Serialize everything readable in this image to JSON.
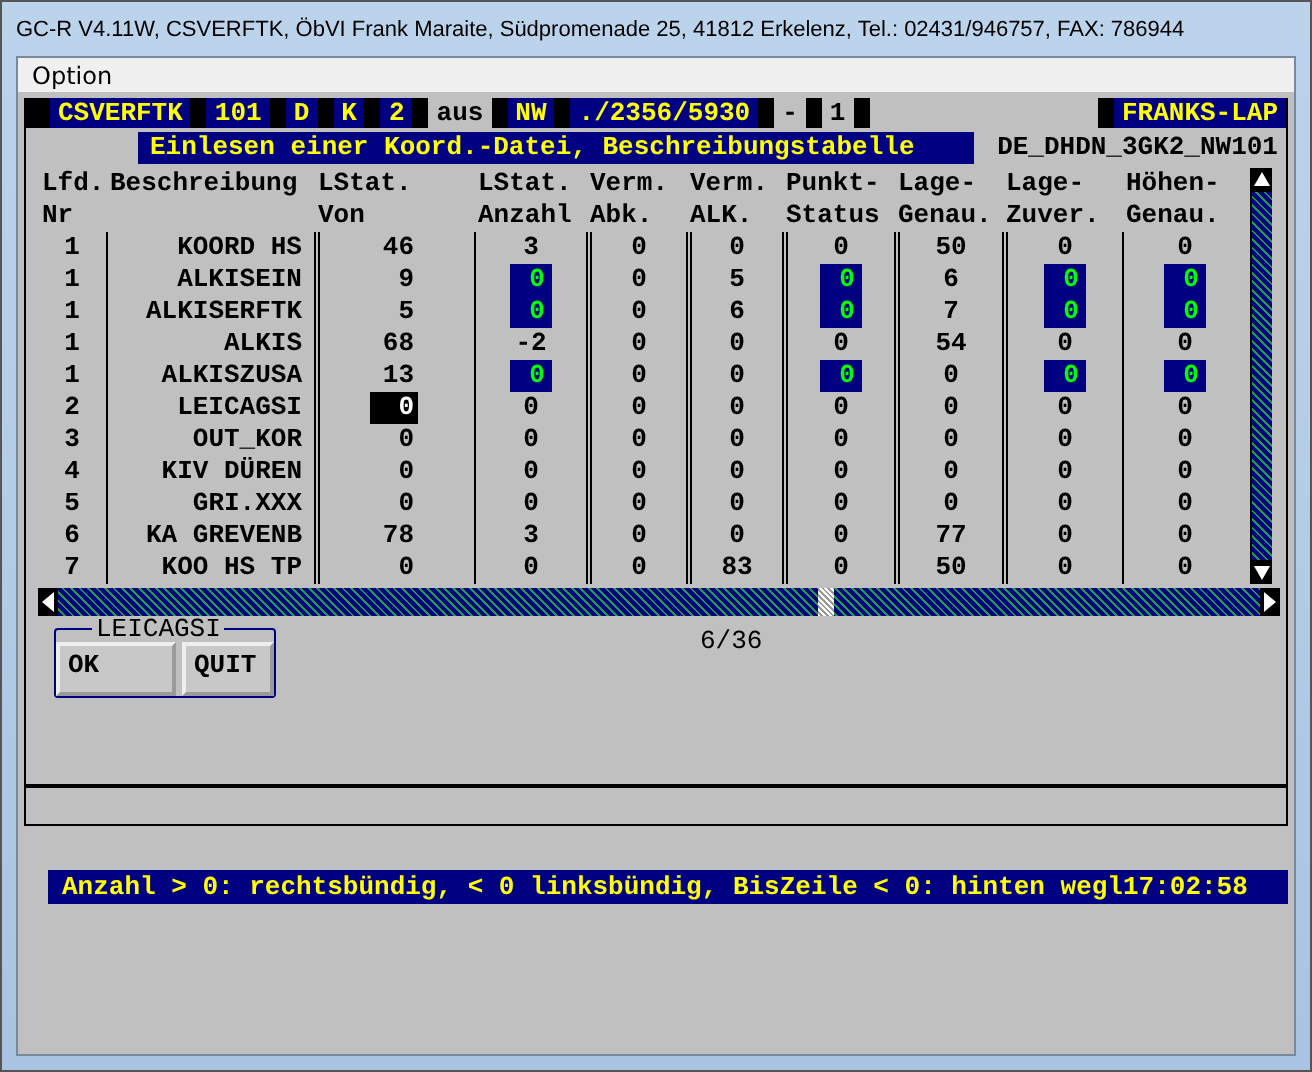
{
  "window": {
    "title": "GC-R V4.11W, CSVERFTK, ÖbVI Frank Maraite, Südpromenade 25, 41812 Erkelenz, Tel.: 02431/946757, FAX: 786944"
  },
  "menu": [
    "Option"
  ],
  "top_bar": [
    {
      "text": "CSVERFTK",
      "highlighted": true
    },
    {
      "text": "101",
      "highlighted": true
    },
    {
      "text": "D",
      "highlighted": true
    },
    {
      "text": "K",
      "highlighted": true
    },
    {
      "text": "2",
      "highlighted": true
    },
    {
      "text": "aus",
      "highlighted": false
    },
    {
      "text": "NW",
      "highlighted": true
    },
    {
      "text": "./2356/5930",
      "highlighted": true
    },
    {
      "text": "-",
      "highlighted": false
    },
    {
      "text": "1",
      "highlighted": false
    },
    {
      "text": "FRANKS-LAP",
      "highlighted": true
    }
  ],
  "heading": {
    "title": "Einlesen einer Koord.-Datei, Beschreibungstabelle",
    "file": "DE_DHDN_3GK2_NW101"
  },
  "table": {
    "columns": [
      {
        "line1": "Lfd.",
        "line2": "Nr"
      },
      {
        "line2": "Beschreibung"
      },
      {
        "line1": "LStat.",
        "line2": "Von"
      },
      {
        "line1": "LStat.",
        "line2": "Anzahl"
      },
      {
        "line1": "Verm.",
        "line2": "Abk."
      },
      {
        "line1": "Verm.",
        "line2": "ALK."
      },
      {
        "line1": "Punkt-",
        "line2": "Status"
      },
      {
        "line1": "Lage-",
        "line2": "Genau."
      },
      {
        "line1": "Lage-",
        "line2": "Zuver."
      },
      {
        "line1": "Höhen-",
        "line2": "Genau."
      }
    ],
    "rows": [
      {
        "cells": [
          {
            "text": "1",
            "highlighted": false,
            "selected": false
          },
          {
            "text": "KOORD HS",
            "highlighted": false,
            "selected": false
          },
          {
            "text": "46",
            "highlighted": false,
            "selected": false
          },
          {
            "text": "3",
            "highlighted": false,
            "selected": false
          },
          {
            "text": "0",
            "highlighted": false,
            "selected": false
          },
          {
            "text": "0",
            "highlighted": false,
            "selected": false
          },
          {
            "text": "0",
            "highlighted": false,
            "selected": false
          },
          {
            "text": "50",
            "highlighted": false,
            "selected": false
          },
          {
            "text": "0",
            "highlighted": false,
            "selected": false
          },
          {
            "text": "0",
            "highlighted": false,
            "selected": false
          }
        ]
      },
      {
        "cells": [
          {
            "text": "1",
            "highlighted": false,
            "selected": false
          },
          {
            "text": "ALKISEIN",
            "highlighted": false,
            "selected": false
          },
          {
            "text": "9",
            "highlighted": false,
            "selected": false
          },
          {
            "text": "0",
            "highlighted": true,
            "selected": false
          },
          {
            "text": "0",
            "highlighted": false,
            "selected": false
          },
          {
            "text": "5",
            "highlighted": false,
            "selected": false
          },
          {
            "text": "0",
            "highlighted": true,
            "selected": false
          },
          {
            "text": "6",
            "highlighted": false,
            "selected": false
          },
          {
            "text": "0",
            "highlighted": true,
            "selected": false
          },
          {
            "text": "0",
            "highlighted": true,
            "selected": false
          }
        ]
      },
      {
        "cells": [
          {
            "text": "1",
            "highlighted": false,
            "selected": false
          },
          {
            "text": "ALKISERFTK",
            "highlighted": false,
            "selected": false
          },
          {
            "text": "5",
            "highlighted": false,
            "selected": false
          },
          {
            "text": "0",
            "highlighted": true,
            "selected": false
          },
          {
            "text": "0",
            "highlighted": false,
            "selected": false
          },
          {
            "text": "6",
            "highlighted": false,
            "selected": false
          },
          {
            "text": "0",
            "highlighted": true,
            "selected": false
          },
          {
            "text": "7",
            "highlighted": false,
            "selected": false
          },
          {
            "text": "0",
            "highlighted": true,
            "selected": false
          },
          {
            "text": "0",
            "highlighted": true,
            "selected": false
          }
        ]
      },
      {
        "cells": [
          {
            "text": "1",
            "highlighted": false,
            "selected": false
          },
          {
            "text": "ALKIS",
            "highlighted": false,
            "selected": false
          },
          {
            "text": "68",
            "highlighted": false,
            "selected": false
          },
          {
            "text": "-2",
            "highlighted": false,
            "selected": false
          },
          {
            "text": "0",
            "highlighted": false,
            "selected": false
          },
          {
            "text": "0",
            "highlighted": false,
            "selected": false
          },
          {
            "text": "0",
            "highlighted": false,
            "selected": false
          },
          {
            "text": "54",
            "highlighted": false,
            "selected": false
          },
          {
            "text": "0",
            "highlighted": false,
            "selected": false
          },
          {
            "text": "0",
            "highlighted": false,
            "selected": false
          }
        ]
      },
      {
        "cells": [
          {
            "text": "1",
            "highlighted": false,
            "selected": false
          },
          {
            "text": "ALKISZUSA",
            "highlighted": false,
            "selected": false
          },
          {
            "text": "13",
            "highlighted": false,
            "selected": false
          },
          {
            "text": "0",
            "highlighted": true,
            "selected": false
          },
          {
            "text": "0",
            "highlighted": false,
            "selected": false
          },
          {
            "text": "0",
            "highlighted": false,
            "selected": false
          },
          {
            "text": "0",
            "highlighted": true,
            "selected": false
          },
          {
            "text": "0",
            "highlighted": false,
            "selected": false
          },
          {
            "text": "0",
            "highlighted": true,
            "selected": false
          },
          {
            "text": "0",
            "highlighted": true,
            "selected": false
          }
        ]
      },
      {
        "cells": [
          {
            "text": "2",
            "highlighted": false,
            "selected": false
          },
          {
            "text": "LEICAGSI",
            "highlighted": false,
            "selected": false
          },
          {
            "text": "0",
            "highlighted": false,
            "selected": true
          },
          {
            "text": "0",
            "highlighted": false,
            "selected": false
          },
          {
            "text": "0",
            "highlighted": false,
            "selected": false
          },
          {
            "text": "0",
            "highlighted": false,
            "selected": false
          },
          {
            "text": "0",
            "highlighted": false,
            "selected": false
          },
          {
            "text": "0",
            "highlighted": false,
            "selected": false
          },
          {
            "text": "0",
            "highlighted": false,
            "selected": false
          },
          {
            "text": "0",
            "highlighted": false,
            "selected": false
          }
        ]
      },
      {
        "cells": [
          {
            "text": "3",
            "highlighted": false,
            "selected": false
          },
          {
            "text": "OUT_KOR",
            "highlighted": false,
            "selected": false
          },
          {
            "text": "0",
            "highlighted": false,
            "selected": false
          },
          {
            "text": "0",
            "highlighted": false,
            "selected": false
          },
          {
            "text": "0",
            "highlighted": false,
            "selected": false
          },
          {
            "text": "0",
            "highlighted": false,
            "selected": false
          },
          {
            "text": "0",
            "highlighted": false,
            "selected": false
          },
          {
            "text": "0",
            "highlighted": false,
            "selected": false
          },
          {
            "text": "0",
            "highlighted": false,
            "selected": false
          },
          {
            "text": "0",
            "highlighted": false,
            "selected": false
          }
        ]
      },
      {
        "cells": [
          {
            "text": "4",
            "highlighted": false,
            "selected": false
          },
          {
            "text": "KIV DÜREN",
            "highlighted": false,
            "selected": false
          },
          {
            "text": "0",
            "highlighted": false,
            "selected": false
          },
          {
            "text": "0",
            "highlighted": false,
            "selected": false
          },
          {
            "text": "0",
            "highlighted": false,
            "selected": false
          },
          {
            "text": "0",
            "highlighted": false,
            "selected": false
          },
          {
            "text": "0",
            "highlighted": false,
            "selected": false
          },
          {
            "text": "0",
            "highlighted": false,
            "selected": false
          },
          {
            "text": "0",
            "highlighted": false,
            "selected": false
          },
          {
            "text": "0",
            "highlighted": false,
            "selected": false
          }
        ]
      },
      {
        "cells": [
          {
            "text": "5",
            "highlighted": false,
            "selected": false
          },
          {
            "text": "GRI.XXX",
            "highlighted": false,
            "selected": false
          },
          {
            "text": "0",
            "highlighted": false,
            "selected": false
          },
          {
            "text": "0",
            "highlighted": false,
            "selected": false
          },
          {
            "text": "0",
            "highlighted": false,
            "selected": false
          },
          {
            "text": "0",
            "highlighted": false,
            "selected": false
          },
          {
            "text": "0",
            "highlighted": false,
            "selected": false
          },
          {
            "text": "0",
            "highlighted": false,
            "selected": false
          },
          {
            "text": "0",
            "highlighted": false,
            "selected": false
          },
          {
            "text": "0",
            "highlighted": false,
            "selected": false
          }
        ]
      },
      {
        "cells": [
          {
            "text": "6",
            "highlighted": false,
            "selected": false
          },
          {
            "text": "KA GREVENB",
            "highlighted": false,
            "selected": false
          },
          {
            "text": "78",
            "highlighted": false,
            "selected": false
          },
          {
            "text": "3",
            "highlighted": false,
            "selected": false
          },
          {
            "text": "0",
            "highlighted": false,
            "selected": false
          },
          {
            "text": "0",
            "highlighted": false,
            "selected": false
          },
          {
            "text": "0",
            "highlighted": false,
            "selected": false
          },
          {
            "text": "77",
            "highlighted": false,
            "selected": false
          },
          {
            "text": "0",
            "highlighted": false,
            "selected": false
          },
          {
            "text": "0",
            "highlighted": false,
            "selected": false
          }
        ]
      },
      {
        "cells": [
          {
            "text": "7",
            "highlighted": false,
            "selected": false
          },
          {
            "text": "KOO HS TP",
            "highlighted": false,
            "selected": false
          },
          {
            "text": "0",
            "highlighted": false,
            "selected": false
          },
          {
            "text": "0",
            "highlighted": false,
            "selected": false
          },
          {
            "text": "0",
            "highlighted": false,
            "selected": false
          },
          {
            "text": "83",
            "highlighted": false,
            "selected": false
          },
          {
            "text": "0",
            "highlighted": false,
            "selected": false
          },
          {
            "text": "50",
            "highlighted": false,
            "selected": false
          },
          {
            "text": "0",
            "highlighted": false,
            "selected": false
          },
          {
            "text": "0",
            "highlighted": false,
            "selected": false
          }
        ]
      }
    ]
  },
  "button_group": {
    "label": "LEICAGSI",
    "buttons": [
      "OK",
      "QUIT"
    ]
  },
  "position": "6/36",
  "status_bar": {
    "message": "Anzahl > 0: rechtsbündig, < 0 linksbündig, BisZeile < 0: hinten wegl",
    "time": "17:02:58"
  }
}
